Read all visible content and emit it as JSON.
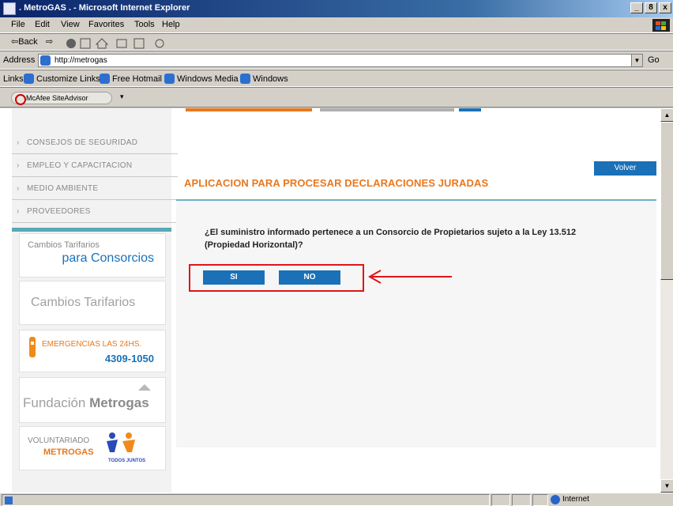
{
  "window": {
    "title": ". MetroGAS . - Microsoft Internet Explorer",
    "buttons": [
      "_",
      "8",
      "x"
    ]
  },
  "menu": [
    "File",
    "Edit",
    "View",
    "Favorites",
    "Tools",
    "Help"
  ],
  "toolbar": {
    "back": "⇦Back",
    "forward": "⇨",
    "icons": [
      "stop-icon",
      "refresh-icon",
      "home-icon",
      "print-icon",
      "edit-icon",
      "messenger-icon"
    ]
  },
  "address": {
    "label": "Address",
    "value": "http://metrogas",
    "go": "Go"
  },
  "links": {
    "label": "Links",
    "items": [
      "Customize Links",
      "Free Hotmail",
      "Windows Media",
      "Windows"
    ]
  },
  "mcafee": {
    "label": "McAfee SiteAdvisor",
    "menu": "▾"
  },
  "sidebar": {
    "nav": [
      "CONSEJOS DE SEGURIDAD",
      "EMPLEO Y CAPACITACION",
      "MEDIO AMBIENTE",
      "PROVEEDORES"
    ],
    "banners": {
      "consorcios": {
        "line1": "Cambios Tarifarios",
        "line2": "para Consorcios"
      },
      "tarifarios": {
        "text": "Cambios Tarifarios"
      },
      "emergencias": {
        "line1": "EMERGENCIAS LAS 24HS.",
        "line2": "4309-1050"
      },
      "fundacion": {
        "text1": "Fundación ",
        "text2": "Metrogas"
      },
      "voluntariado": {
        "line1": "VOLUNTARIADO",
        "line2": "METROGAS",
        "tag": "TODOS JUNTOS"
      }
    }
  },
  "main": {
    "volver": "Volver",
    "heading": "APLICACION PARA PROCESAR DECLARACIONES JURADAS",
    "question": "¿El suministro informado pertenece a un Consorcio de Propietarios sujeto a la Ley 13.512 (Propiedad Horizontal)?",
    "yes": "SI",
    "no": "NO"
  },
  "status": {
    "zone": "Internet"
  },
  "colors": {
    "accent": "#1a71b8",
    "heading": "#e8781e",
    "highlight": "#e0141a"
  }
}
